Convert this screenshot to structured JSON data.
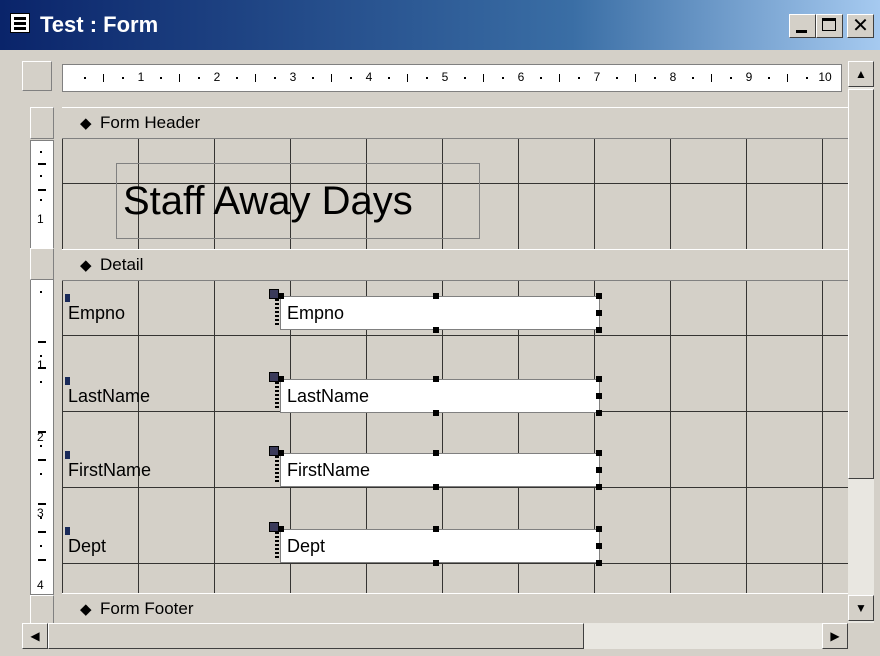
{
  "window": {
    "title": "Test : Form"
  },
  "ruler": {
    "horizontal_numbers": [
      "1",
      "2",
      "3",
      "4",
      "5",
      "6",
      "7",
      "8",
      "9",
      "10"
    ],
    "vertical_numbers": [
      "1",
      "1",
      "2",
      "3",
      "4"
    ]
  },
  "sections": {
    "header": "Form Header",
    "detail": "Detail",
    "footer": "Form Footer"
  },
  "form_title": "Staff Away Days",
  "fields": [
    {
      "label": "Empno",
      "control": "Empno"
    },
    {
      "label": "LastName",
      "control": "LastName"
    },
    {
      "label": "FirstName",
      "control": "FirstName"
    },
    {
      "label": "Dept",
      "control": "Dept"
    }
  ],
  "icons": {
    "section_marker": "arrow-down-bar-icon",
    "minimize": "minimize-icon",
    "maximize": "maximize-icon",
    "close": "close-icon"
  }
}
